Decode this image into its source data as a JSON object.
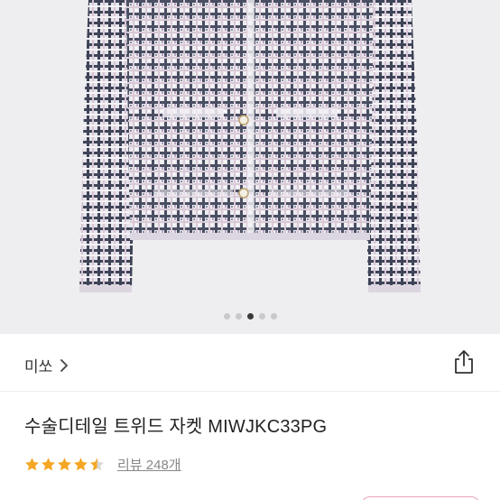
{
  "carousel": {
    "page_count": 5,
    "active_index": 2
  },
  "brand": {
    "name": "미쏘",
    "chevron": "chevron-right-icon"
  },
  "share": {
    "icon": "share-icon"
  },
  "product": {
    "title": "수술디테일 트위드 자켓 MIWJKC33PG"
  },
  "rating": {
    "stars": 4.5,
    "max_stars": 5,
    "star_color": "#f5a623",
    "review_text": "리뷰 248개"
  }
}
